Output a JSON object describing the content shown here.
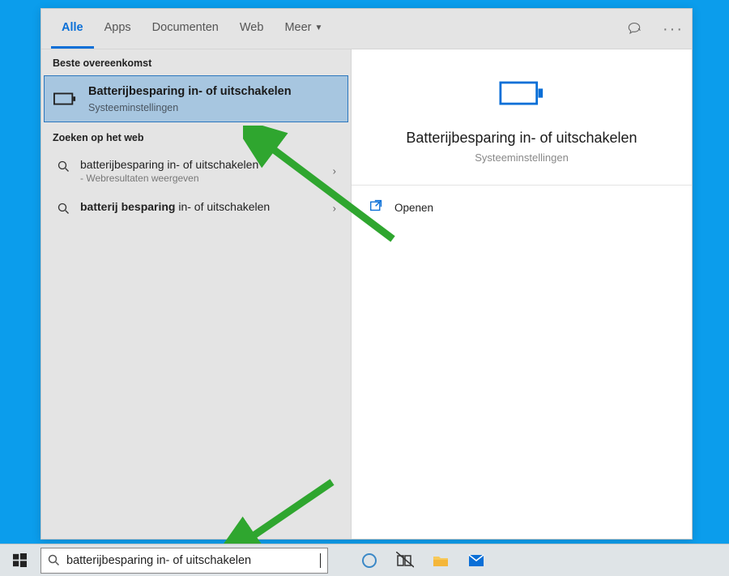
{
  "header": {
    "tabs": [
      "Alle",
      "Apps",
      "Documenten",
      "Web",
      "Meer"
    ]
  },
  "left": {
    "best_match_label": "Beste overeenkomst",
    "best_match": {
      "title": "Batterijbesparing in- of uitschakelen",
      "subtitle": "Systeeminstellingen"
    },
    "web_label": "Zoeken op het web",
    "web_items": [
      {
        "text": "batterijbesparing in- of uitschakelen",
        "sub": "- Webresultaten weergeven",
        "bold_prefix": ""
      },
      {
        "text": " in- of uitschakelen",
        "sub": "",
        "bold_prefix": "batterij besparing"
      }
    ]
  },
  "preview": {
    "title": "Batterijbesparing in- of uitschakelen",
    "subtitle": "Systeeminstellingen",
    "open_label": "Openen"
  },
  "search": {
    "value": "batterijbesparing in- of uitschakelen"
  }
}
